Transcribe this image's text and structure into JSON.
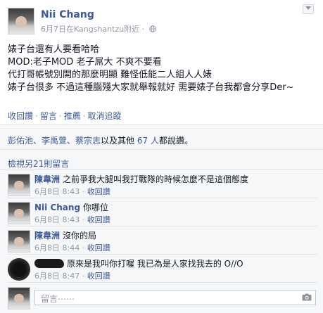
{
  "post": {
    "author": "Nii Chang",
    "meta": "6月7日在Kangshantzu附近 ·",
    "body_lines": [
      "婊子台還有人要看哈哈",
      "MOD:老子MOD 老子屌大 不爽不要看",
      "代打哥帳號別開的那麼明顯 難怪低能二人組人人婊",
      "婊子台很多 不過這種腦殘大家就舉報就好 需要婊子台我都會分享Der~"
    ]
  },
  "actions": {
    "like": "收回讚",
    "comment": "留言",
    "share": "推薦",
    "follow": "取消追蹤",
    "separator": "·"
  },
  "likes": {
    "names": "彭佑池、李禹萱、蔡宗志",
    "middle": "以及其他",
    "count_link": "67 人",
    "suffix": "都說讚。"
  },
  "view_more": "檢視另21則留言",
  "comments": [
    {
      "author": "陳韋洲",
      "text": "之前爭我大腿叫我打戰隊的時候怎麼不是這個態度",
      "time": "6月8日 8:43",
      "like": "收回讚"
    },
    {
      "author": "Nii Chang",
      "text": "你哪位",
      "time": "6月8日 8:43",
      "like": "收回讚"
    },
    {
      "author": "陳韋洲",
      "text": "沒你的局",
      "time": "6月8日 8:44",
      "like": "收回讚"
    },
    {
      "author": "",
      "text": "原來是我叫你打喔 我已為是人家找我去的 O//O",
      "time": "6月8日 8:47",
      "like": "收回讚"
    }
  ],
  "meta_sep": "·",
  "composer": {
    "placeholder": "留言⋯⋯"
  },
  "colors": {
    "link": "#3b5998",
    "muted": "#9197a3",
    "ufi_bg": "#f6f7f9"
  },
  "icons": [
    "globe-icon",
    "chevron-down-icon",
    "camera-icon"
  ]
}
